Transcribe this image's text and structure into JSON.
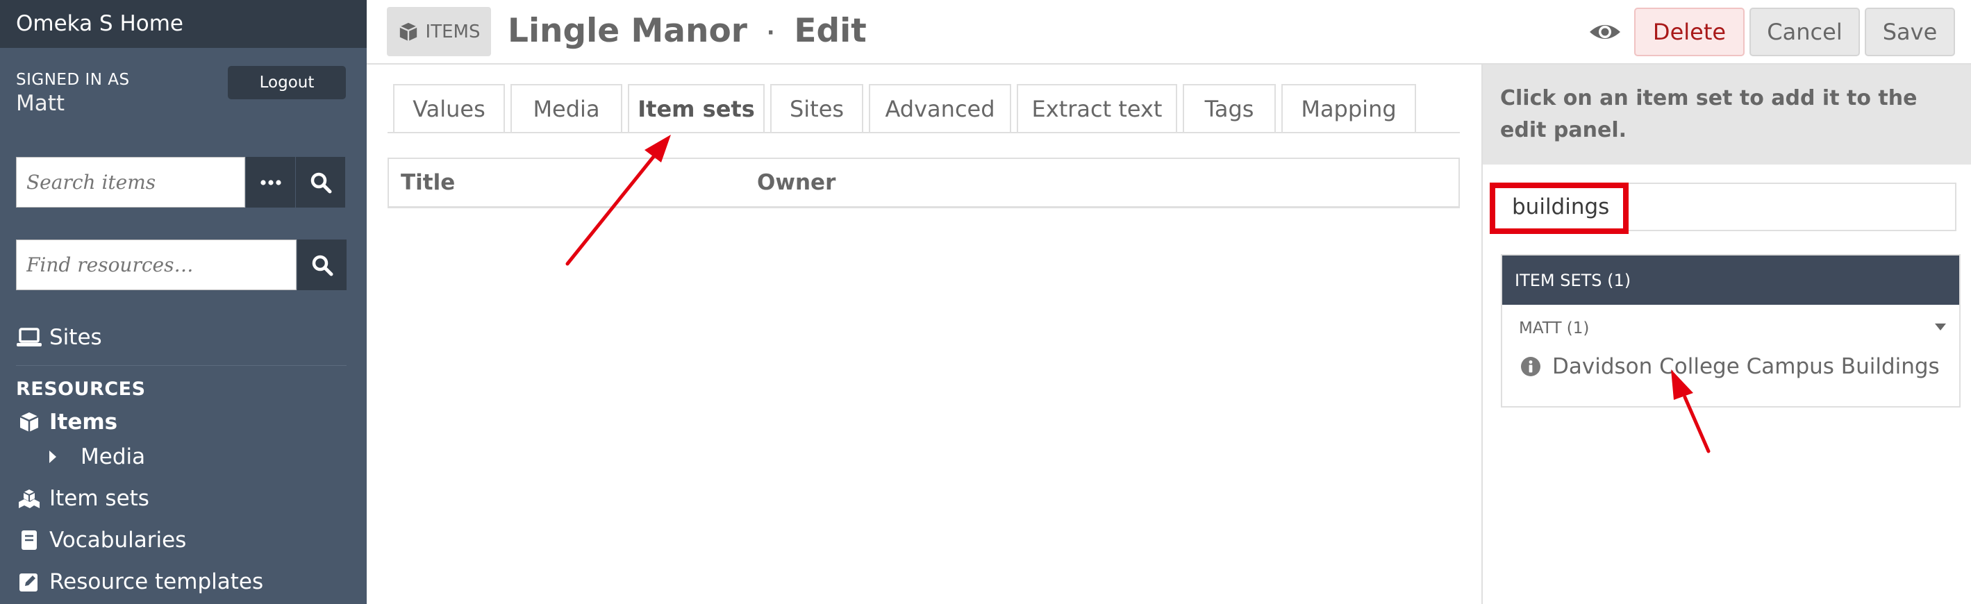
{
  "sidebar": {
    "brand": "Omeka S Home",
    "signed_in_label": "SIGNED IN AS",
    "user_name": "Matt",
    "logout_label": "Logout",
    "search_items_placeholder": "Search items",
    "find_resources_placeholder": "Find resources…",
    "sites_label": "Sites",
    "resources_heading": "RESOURCES",
    "items_label": "Items",
    "media_label": "Media",
    "item_sets_label": "Item sets",
    "vocabularies_label": "Vocabularies",
    "resource_templates_label": "Resource templates"
  },
  "header": {
    "badge_label": "ITEMS",
    "title": "Lingle Manor",
    "separator": "·",
    "mode": "Edit",
    "delete_label": "Delete",
    "cancel_label": "Cancel",
    "save_label": "Save"
  },
  "tabs": [
    {
      "label": "Values",
      "active": false
    },
    {
      "label": "Media",
      "active": false
    },
    {
      "label": "Item sets",
      "active": true
    },
    {
      "label": "Sites",
      "active": false
    },
    {
      "label": "Advanced",
      "active": false
    },
    {
      "label": "Extract text",
      "active": false
    },
    {
      "label": "Tags",
      "active": false
    },
    {
      "label": "Mapping",
      "active": false
    }
  ],
  "table": {
    "col_title": "Title",
    "col_owner": "Owner"
  },
  "right_panel": {
    "instruction": "Click on an item set to add it to the edit panel.",
    "filter_value": "buildings",
    "group_header": "ITEM SETS (1)",
    "owner_group": "MATT (1)",
    "entry_label": "Davidson College Campus Buildings"
  },
  "colors": {
    "sidebar_bg": "#49586b",
    "sidebar_dark": "#323c48",
    "delete_text": "#a91919",
    "annotation_red": "#e3000f"
  },
  "icons": [
    "cube-icon",
    "ellipsis-icon",
    "search-icon",
    "laptop-icon",
    "cubes-icon",
    "book-icon",
    "edit-icon",
    "eye-icon",
    "caret-right-icon",
    "caret-down-icon",
    "info-icon"
  ]
}
